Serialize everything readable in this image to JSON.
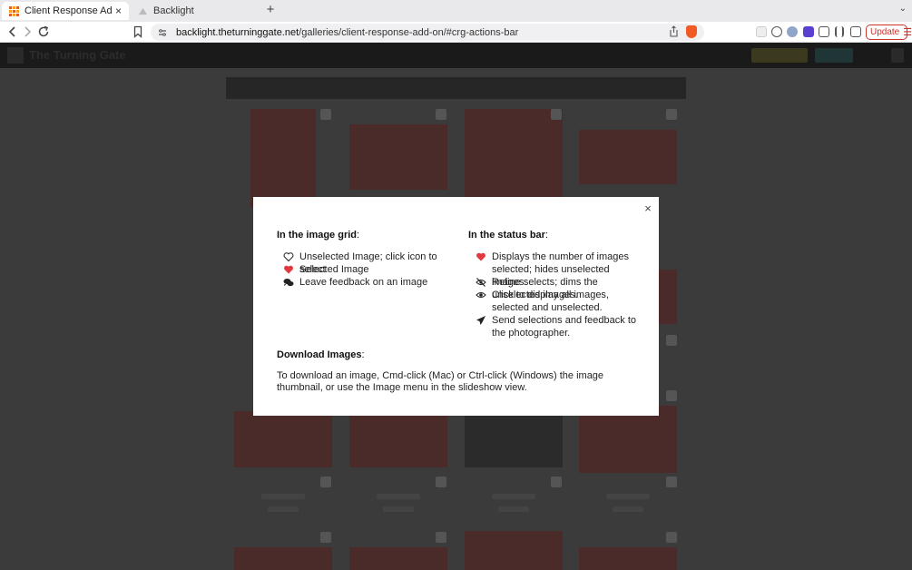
{
  "browser": {
    "tabs": [
      {
        "label": "Client Response Add-on - The",
        "close": "×"
      },
      {
        "label": "Backlight"
      }
    ],
    "new_tab": "+",
    "tabs_menu": "⌄",
    "url_host": "backlight.theturninggate.net",
    "url_path": "/galleries/client-response-add-on/#crg-actions-bar",
    "update_label": "Update"
  },
  "site": {
    "name": "The Turning Gate"
  },
  "dialog": {
    "close_label": "×",
    "grid_section": {
      "title": "In the image grid",
      "items": [
        {
          "icon": "heart-outline-icon",
          "text": "Unselected Image; click icon to select"
        },
        {
          "icon": "heart-filled-icon",
          "text": "Selected Image"
        },
        {
          "icon": "comments-icon",
          "text": "Leave feedback on an image"
        }
      ]
    },
    "status_section": {
      "title": "In the status bar",
      "items": [
        {
          "icon": "heart-filled-icon",
          "text": "Displays the number of images selected; hides unselected images."
        },
        {
          "icon": "eye-slash-icon",
          "text": "Refine selects; dims the unselected images."
        },
        {
          "icon": "eye-icon",
          "text": "Click to display all images, selected and unselected."
        },
        {
          "icon": "send-icon",
          "text": "Send selections and feedback to the photographer."
        }
      ]
    },
    "download": {
      "title": "Download Images",
      "text": "To download an image, Cmd-click (Mac) or Ctrl-click (Windows) the image thumbnail, or use the Image menu in the slideshow view."
    }
  },
  "colors": {
    "heart": "#e0393e",
    "accent_brave": "#f05a24",
    "update": "#c9332b"
  }
}
